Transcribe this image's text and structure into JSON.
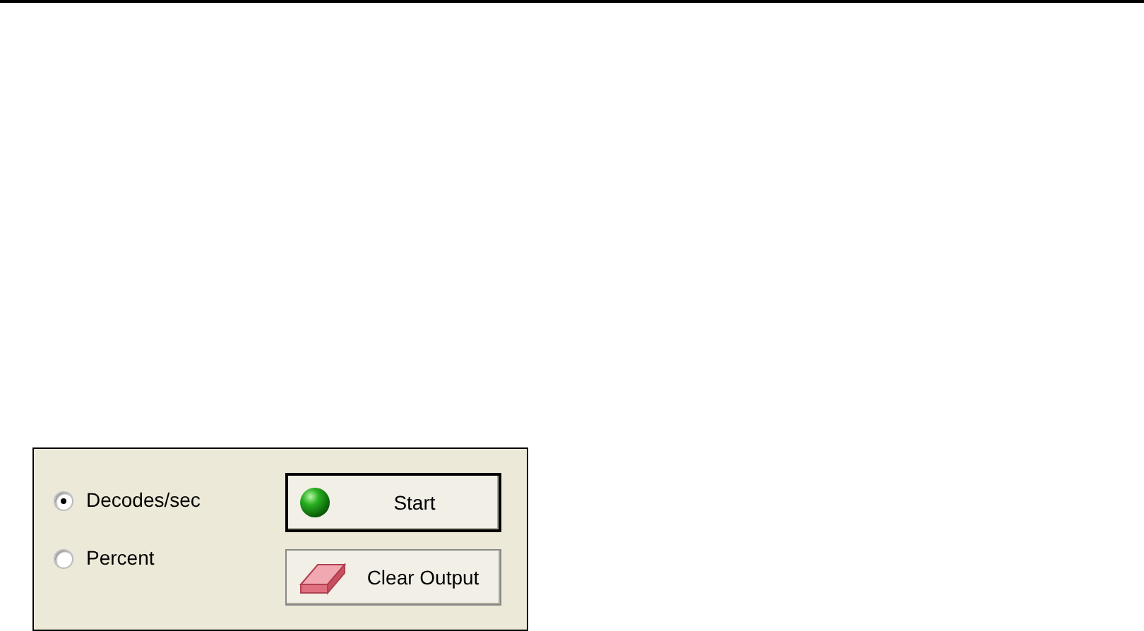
{
  "options": [
    {
      "label": "Decodes/sec",
      "selected": true
    },
    {
      "label": "Percent",
      "selected": false
    }
  ],
  "buttons": [
    {
      "label": "Start",
      "kind": "start",
      "default": true
    },
    {
      "label": "Clear Output",
      "kind": "clear",
      "default": false
    }
  ]
}
